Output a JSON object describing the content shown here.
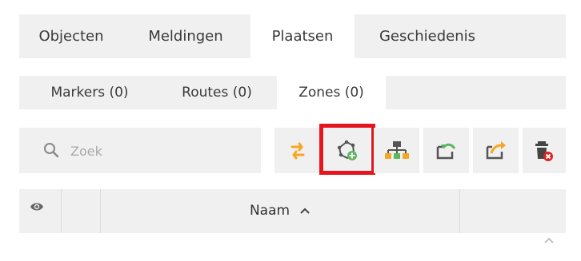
{
  "main_tabs": [
    {
      "label": "Objecten",
      "active": false
    },
    {
      "label": "Meldingen",
      "active": false
    },
    {
      "label": "Plaatsen",
      "active": true
    },
    {
      "label": "Geschiedenis",
      "active": false
    }
  ],
  "sub_tabs": [
    {
      "label": "Markers (0)",
      "active": false
    },
    {
      "label": "Routes (0)",
      "active": false
    },
    {
      "label": "Zones (0)",
      "active": true
    }
  ],
  "search": {
    "placeholder": "Zoek",
    "value": ""
  },
  "toolbar": {
    "buttons": [
      {
        "icon": "refresh-icon"
      },
      {
        "icon": "add-zone-icon",
        "highlighted": true
      },
      {
        "icon": "group-hierarchy-icon"
      },
      {
        "icon": "import-icon"
      },
      {
        "icon": "export-icon"
      },
      {
        "icon": "delete-all-icon"
      }
    ]
  },
  "table": {
    "columns": [
      {
        "label": ""
      },
      {
        "label": ""
      },
      {
        "label": "Naam",
        "sort": "ascending"
      },
      {
        "label": ""
      }
    ]
  },
  "colors": {
    "accent_orange": "#f5a623",
    "accent_green": "#5cb85c",
    "highlight_red": "#e5141e",
    "danger_red": "#e02020",
    "panel_gray": "#f0f0f0"
  }
}
